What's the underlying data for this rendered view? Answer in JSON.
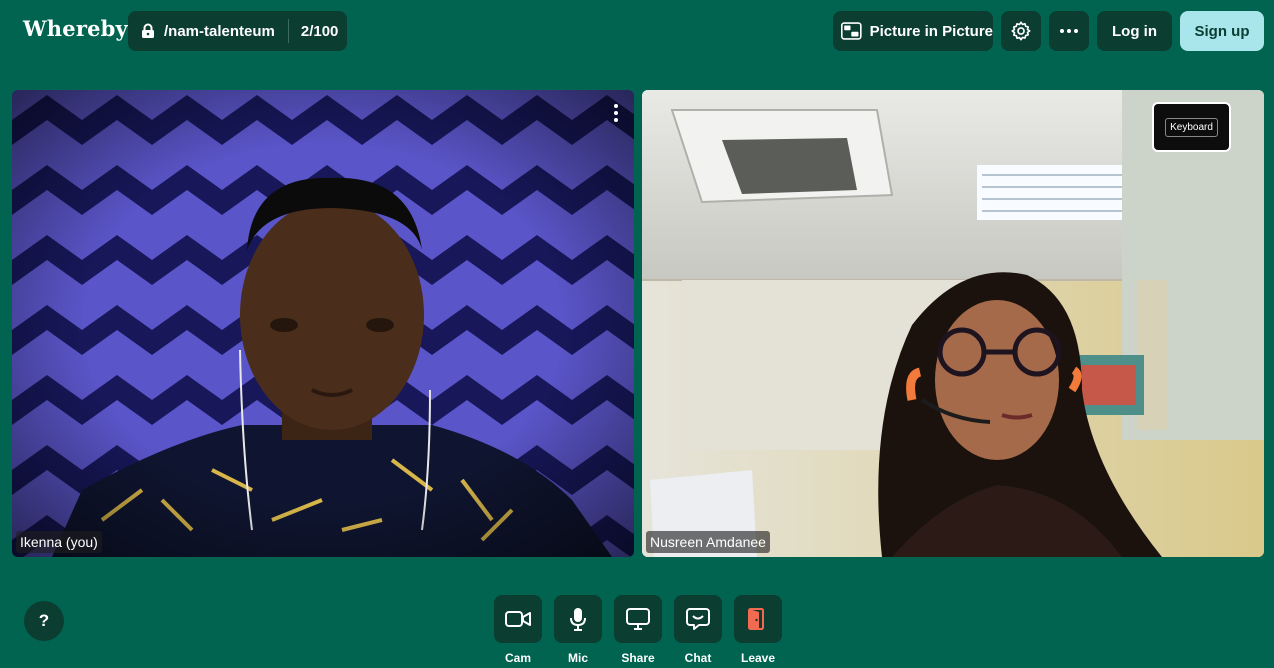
{
  "app": {
    "logo_text": "Whereby",
    "room_name": "/nam-talenteum",
    "participant_count": "2/100"
  },
  "toolbar": {
    "pip_label": "Picture in Picture",
    "login_label": "Log in",
    "signup_label": "Sign up"
  },
  "tiles": [
    {
      "name": "Ikenna (you)"
    },
    {
      "name": "Nusreen Amdanee",
      "badge": "Keyboard"
    }
  ],
  "controls": {
    "help": "?",
    "cam": "Cam",
    "mic": "Mic",
    "share": "Share",
    "chat": "Chat",
    "leave": "Leave"
  },
  "icons": [
    "lock-icon",
    "picture-in-picture-icon",
    "gear-icon",
    "more-icon",
    "camera-icon",
    "microphone-icon",
    "screen-share-icon",
    "chat-icon",
    "leave-door-icon"
  ],
  "colors": {
    "background": "#006450",
    "button_dark": "#0b3d31",
    "signup": "#a9e6ec",
    "leave_accent": "#f26b50"
  }
}
